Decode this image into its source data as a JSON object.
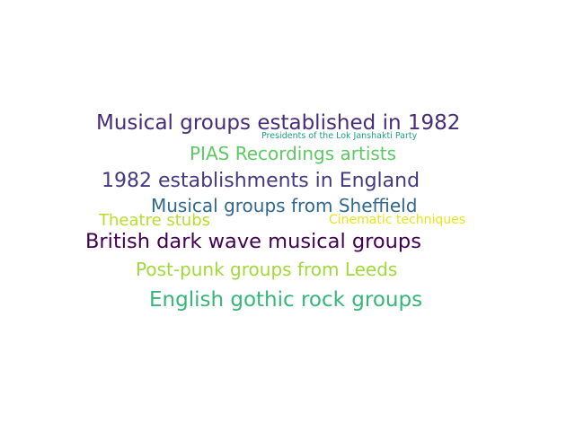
{
  "words": [
    {
      "text": "Musical groups established in 1982",
      "color": "#472c7a"
    },
    {
      "text": "Presidents of the Lok Janshakti Party",
      "color": "#1fa187"
    },
    {
      "text": "PIAS Recordings artists",
      "color": "#5ec962"
    },
    {
      "text": "1982 establishments in England",
      "color": "#443983"
    },
    {
      "text": "Musical groups from Sheffield",
      "color": "#31688e"
    },
    {
      "text": "Theatre stubs",
      "color": "#b5de2b"
    },
    {
      "text": "Cinematic techniques",
      "color": "#e7e419"
    },
    {
      "text": "British dark wave musical groups",
      "color": "#440154"
    },
    {
      "text": "Post-punk groups from Leeds",
      "color": "#a0da39"
    },
    {
      "text": "English gothic rock groups",
      "color": "#35b779"
    }
  ]
}
